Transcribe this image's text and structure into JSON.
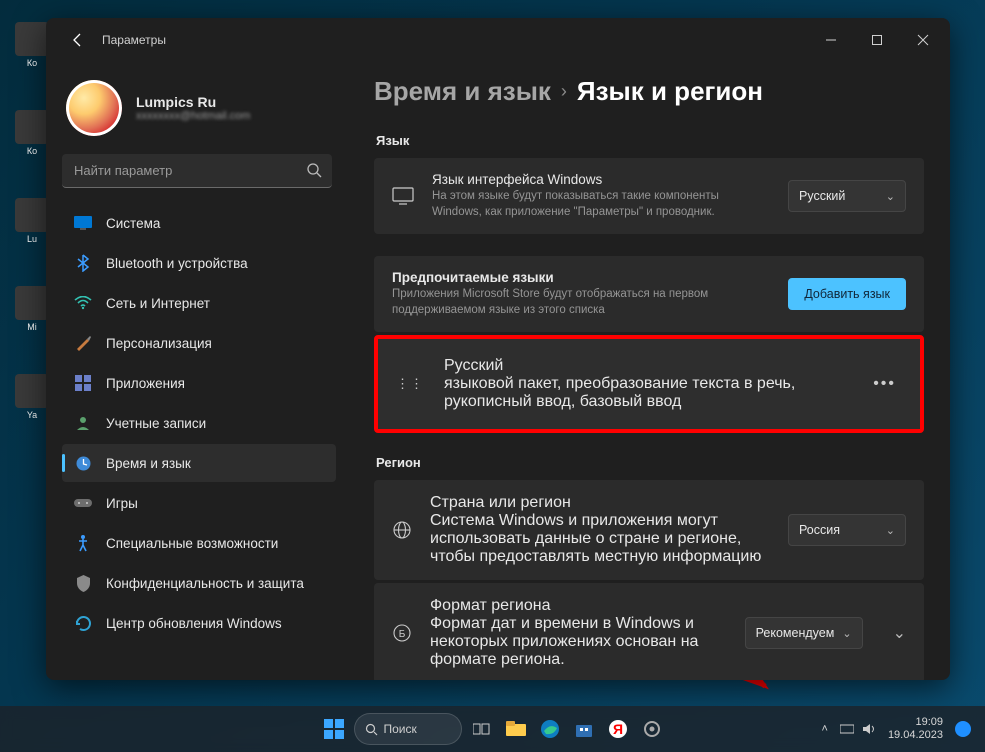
{
  "window": {
    "title": "Параметры",
    "user": {
      "name": "Lumpics Ru",
      "email_blur": "xxxxxxxx",
      "email_suffix": "@hotmail.com"
    },
    "search_placeholder": "Найти параметр"
  },
  "sidebar": {
    "items": [
      {
        "label": "Система",
        "icon": "system"
      },
      {
        "label": "Bluetooth и устройства",
        "icon": "bluetooth"
      },
      {
        "label": "Сеть и Интернет",
        "icon": "wifi"
      },
      {
        "label": "Персонализация",
        "icon": "brush"
      },
      {
        "label": "Приложения",
        "icon": "apps"
      },
      {
        "label": "Учетные записи",
        "icon": "user"
      },
      {
        "label": "Время и язык",
        "icon": "clock",
        "active": true
      },
      {
        "label": "Игры",
        "icon": "gamepad"
      },
      {
        "label": "Специальные возможности",
        "icon": "access"
      },
      {
        "label": "Конфиденциальность и защита",
        "icon": "shield"
      },
      {
        "label": "Центр обновления Windows",
        "icon": "update"
      }
    ]
  },
  "main": {
    "breadcrumb1": "Время и язык",
    "breadcrumb2": "Язык и регион",
    "section_lang": "Язык",
    "winlang": {
      "title": "Язык интерфейса Windows",
      "desc": "На этом языке будут показываться такие компоненты Windows, как приложение \"Параметры\" и проводник.",
      "value": "Русский"
    },
    "preflang": {
      "title": "Предпочитаемые языки",
      "desc": "Приложения Microsoft Store будут отображаться на первом поддерживаемом языке из этого списка",
      "add_label": "Добавить язык"
    },
    "lang_item": {
      "name": "Русский",
      "desc": "языковой пакет, преобразование текста в речь, рукописный ввод, базовый ввод"
    },
    "section_region": "Регион",
    "country": {
      "title": "Страна или регион",
      "desc": "Система Windows и приложения могут использовать данные о стране и регионе, чтобы предоставлять местную информацию",
      "value": "Россия"
    },
    "format": {
      "title": "Формат региона",
      "desc": "Формат дат и времени в Windows и некоторых приложениях основан на формате региона.",
      "value": "Рекомендуем"
    }
  },
  "taskbar": {
    "search": "Поиск",
    "time": "19:09",
    "date": "19.04.2023"
  }
}
